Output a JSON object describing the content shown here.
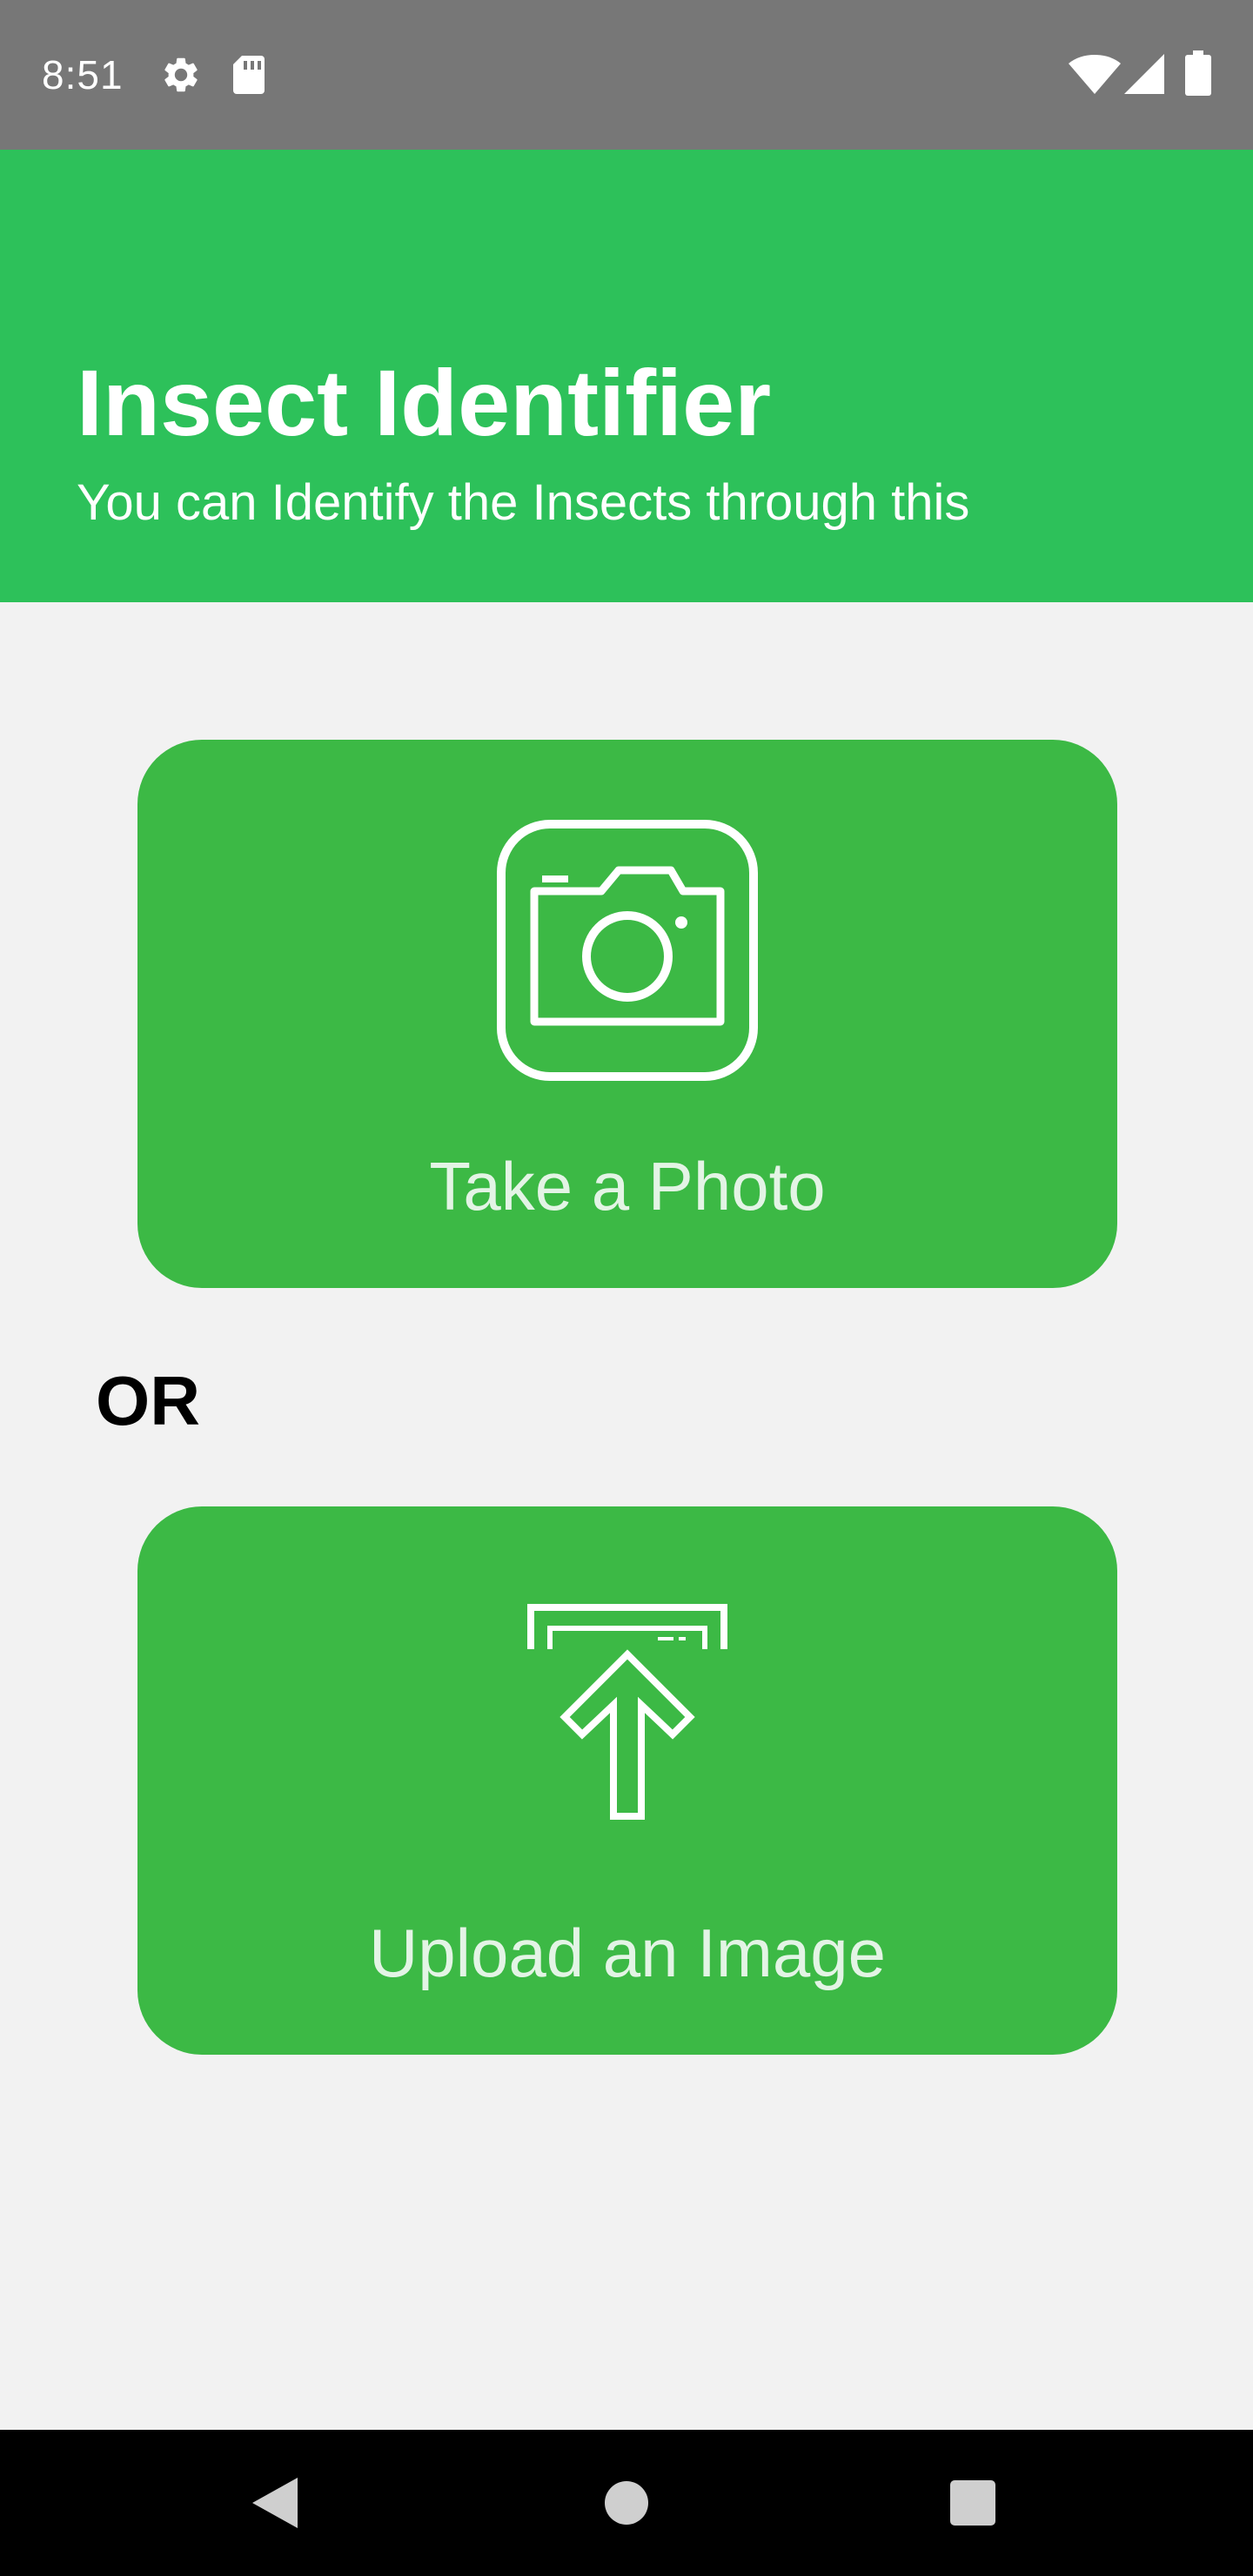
{
  "status_bar": {
    "time": "8:51",
    "icons": [
      "gear-icon",
      "sd-card-icon",
      "wifi-icon",
      "cell-signal-icon",
      "battery-icon"
    ],
    "color": "#777777"
  },
  "header": {
    "title": "Insect Identifier",
    "subtitle": "You can Identify the Insects through this",
    "background_color": "#2dc15a"
  },
  "actions": {
    "take_photo": {
      "label": "Take a Photo",
      "icon": "camera-icon"
    },
    "separator": "OR",
    "upload_image": {
      "label": "Upload an Image",
      "icon": "upload-icon"
    },
    "card_color": "#3cb945"
  },
  "nav_bar": {
    "buttons": [
      "back-icon",
      "home-icon",
      "recents-icon"
    ]
  }
}
